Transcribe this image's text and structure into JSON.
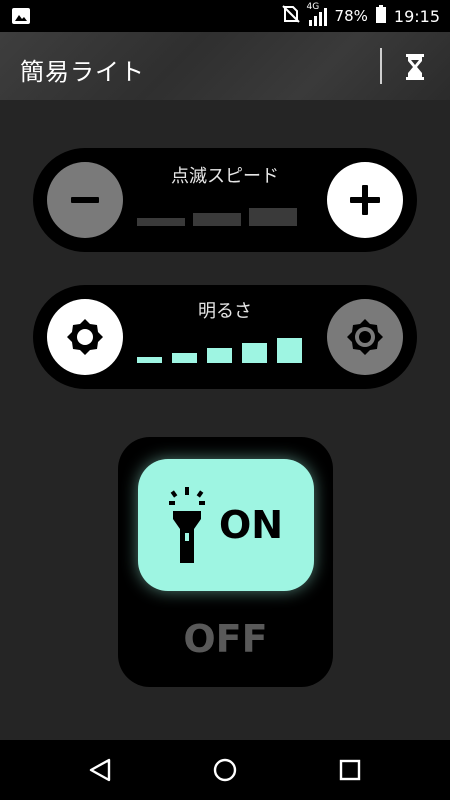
{
  "status_bar": {
    "network": "4G",
    "battery": "78%",
    "time": "19:15"
  },
  "app_bar": {
    "title": "簡易ライト",
    "timer_icon": "hourglass-icon"
  },
  "blink_speed": {
    "label": "点滅スピード",
    "decrease_icon": "minus-icon",
    "increase_icon": "plus-icon",
    "levels_total": 3,
    "level_active": 0
  },
  "brightness": {
    "label": "明るさ",
    "decrease_icon": "brightness-low-icon",
    "increase_icon": "brightness-high-icon",
    "levels_total": 5,
    "level_active": 5
  },
  "light_toggle": {
    "on_label": "ON",
    "off_label": "OFF",
    "state": "on",
    "icon": "flashlight-icon"
  },
  "colors": {
    "accent": "#9ef5e2",
    "background": "#252525",
    "panel": "#000000",
    "inactive_button": "#7a7a7a",
    "level_inactive": "#3a3a3a"
  },
  "nav_bar": {
    "back_icon": "back-icon",
    "home_icon": "home-icon",
    "recents_icon": "recents-icon"
  }
}
